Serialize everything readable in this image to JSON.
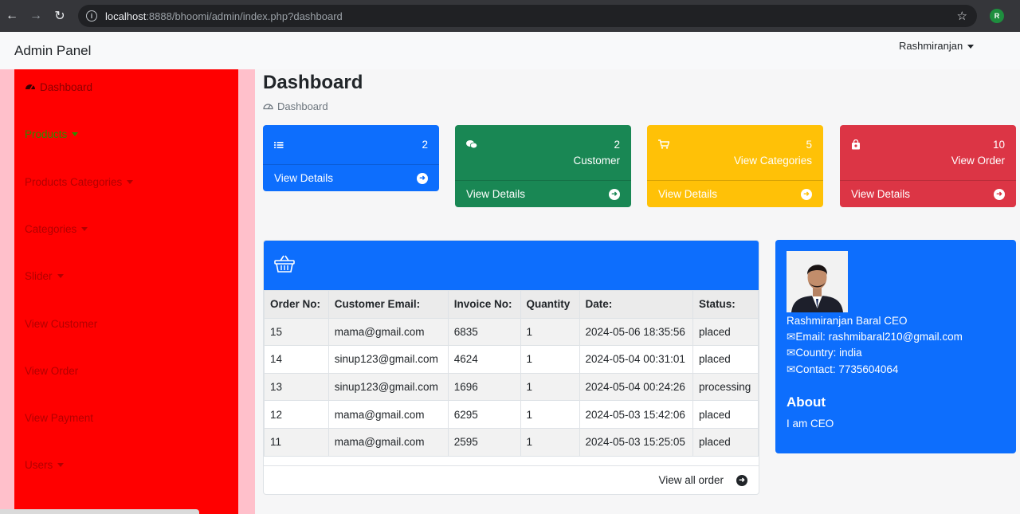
{
  "browser": {
    "url_host": "localhost",
    "url_path": ":8888/bhoomi/admin/index.php?dashboard",
    "profile_initial": "R"
  },
  "navbar": {
    "brand": "Admin Panel",
    "user": "Rashmiranjan"
  },
  "sidebar": {
    "items": [
      {
        "label": "Dashboard",
        "icon": "gauge-icon"
      },
      {
        "label": "Products",
        "dropdown": true
      },
      {
        "label": "Products Categories",
        "dropdown": true
      },
      {
        "label": "Categories",
        "dropdown": true
      },
      {
        "label": "Slider",
        "dropdown": true
      },
      {
        "label": "View Customer"
      },
      {
        "label": "View Order"
      },
      {
        "label": "View Payment"
      },
      {
        "label": "Users",
        "dropdown": true
      }
    ]
  },
  "page": {
    "title": "Dashboard",
    "breadcrumb": "Dashboard"
  },
  "cards": [
    {
      "count": "2",
      "sub": "",
      "footer": "View Details",
      "icon": "list-icon",
      "color": "#0d6efd"
    },
    {
      "count": "2",
      "sub": "Customer",
      "footer": "View Details",
      "icon": "chat-icon",
      "color": "#198754"
    },
    {
      "count": "5",
      "sub": "View Categories",
      "footer": "View Details",
      "icon": "cart-icon",
      "color": "#ffc107"
    },
    {
      "count": "10",
      "sub": "View Order",
      "footer": "View Details",
      "icon": "bag-icon",
      "color": "#dc3545"
    }
  ],
  "orders": {
    "columns": [
      "Order No:",
      "Customer Email:",
      "Invoice No:",
      "Quantity",
      "Date:",
      "Status:"
    ],
    "rows": [
      [
        "15",
        "mama@gmail.com",
        "6835",
        "1",
        "2024-05-06 18:35:56",
        "placed"
      ],
      [
        "14",
        "sinup123@gmail.com",
        "4624",
        "1",
        "2024-05-04 00:31:01",
        "placed"
      ],
      [
        "13",
        "sinup123@gmail.com",
        "1696",
        "1",
        "2024-05-04 00:24:26",
        "processing"
      ],
      [
        "12",
        "mama@gmail.com",
        "6295",
        "1",
        "2024-05-03 15:42:06",
        "placed"
      ],
      [
        "11",
        "mama@gmail.com",
        "2595",
        "1",
        "2024-05-03 15:25:05",
        "placed"
      ]
    ],
    "view_all": "View all order"
  },
  "profile": {
    "name": "Rashmiranjan Baral CEO",
    "email": "Email: rashmibaral210@gmail.com",
    "country": "Country: india",
    "contact": "Contact: 7735604064",
    "about_heading": "About",
    "about_text": "I am CEO"
  }
}
